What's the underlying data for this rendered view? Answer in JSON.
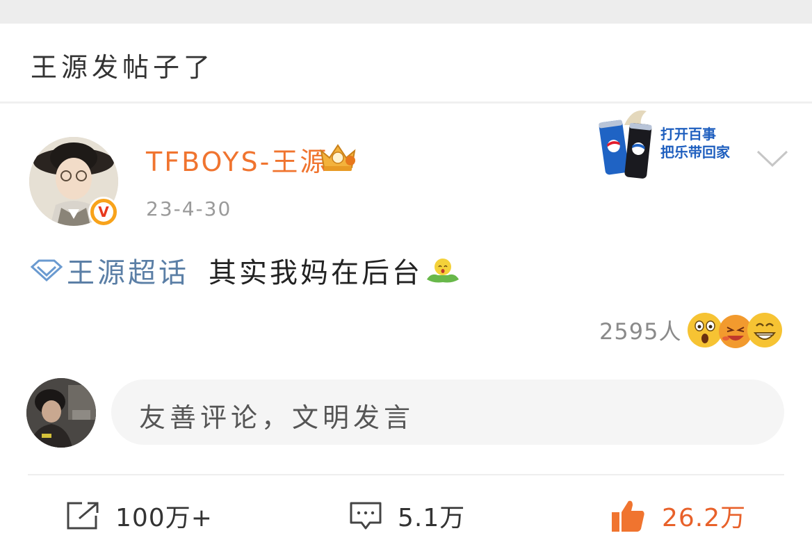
{
  "header": {
    "title": "王源发帖子了"
  },
  "post": {
    "author": "TFBOYS-王源",
    "timestamp": "23-4-30",
    "verified_badge": "V",
    "topic": "王源超话",
    "text": "其实我妈在后台"
  },
  "ad": {
    "line1": "打开百事",
    "line2": "把乐带回家"
  },
  "reactions": {
    "count_label": "2595人"
  },
  "comment_input": {
    "placeholder": "友善评论，文明发言"
  },
  "actions": {
    "repost": "100万+",
    "comments": "5.1万",
    "likes": "26.2万"
  },
  "colors": {
    "username": "#f0742f",
    "topic": "#5b7fa6",
    "like": "#f0742f"
  }
}
